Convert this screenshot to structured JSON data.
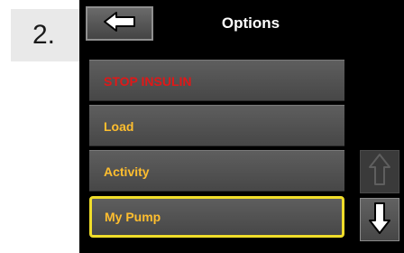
{
  "step": {
    "label": "2."
  },
  "header": {
    "title": "Options"
  },
  "menu": {
    "items": [
      {
        "label": "STOP INSULIN"
      },
      {
        "label": "Load"
      },
      {
        "label": "Activity"
      },
      {
        "label": "My Pump"
      }
    ],
    "selected_index": 3
  },
  "icons": {
    "back": "left-arrow-icon",
    "scroll_up": "up-arrow-icon",
    "scroll_down": "down-arrow-icon"
  },
  "colors": {
    "accent_text": "#ffbe2e",
    "danger_text": "#e01818",
    "selection_border": "#f0dd2a",
    "screen_background": "#000000"
  }
}
